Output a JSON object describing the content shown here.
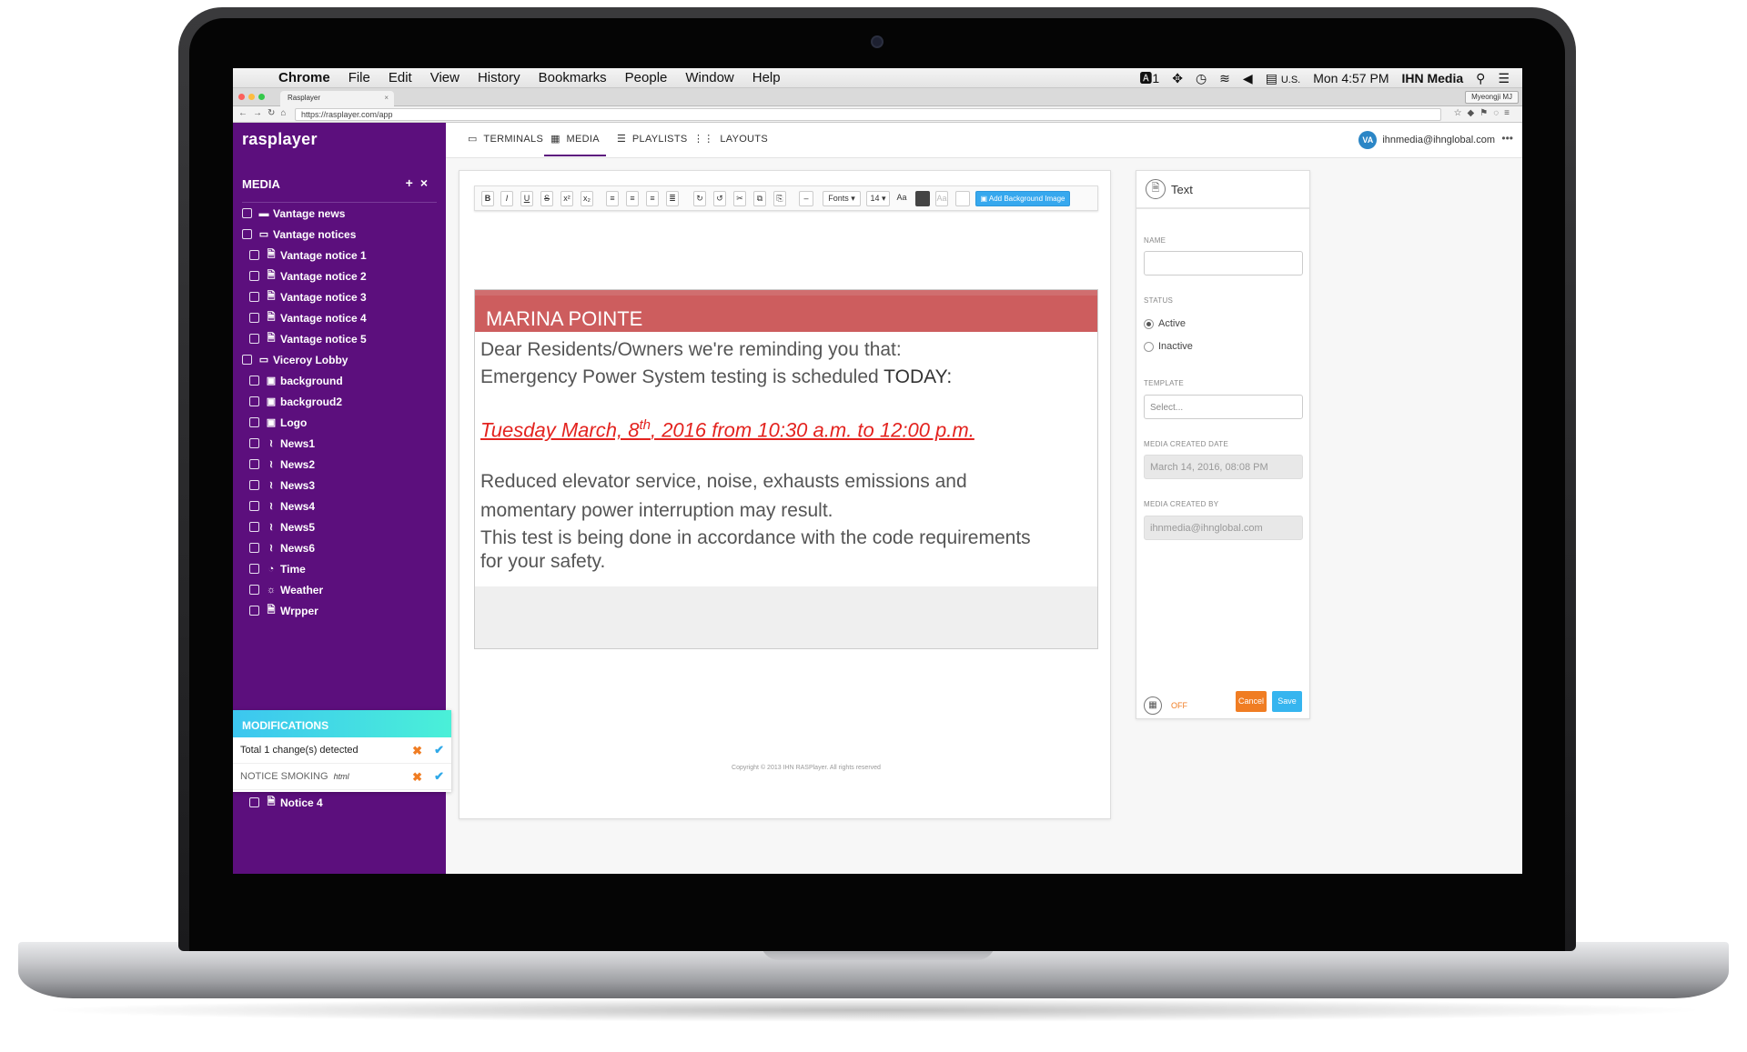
{
  "menubar": {
    "app": "Chrome",
    "items": [
      "File",
      "Edit",
      "View",
      "History",
      "Bookmarks",
      "People",
      "Window",
      "Help"
    ],
    "right": {
      "indicator": "1",
      "locale": "U.S.",
      "clock": "Mon 4:57 PM",
      "user": "IHN Media"
    }
  },
  "browser": {
    "tab_title": "Rasplayer",
    "tab_close": "×",
    "profile": "Myeongji MJ",
    "url": "https://rasplayer.com/app"
  },
  "sidebar": {
    "logo": "rasplayer",
    "media_title": "MEDIA",
    "items": [
      {
        "label": "Vantage news",
        "icon": "folder-icon",
        "indent": 0
      },
      {
        "label": "Vantage notices",
        "icon": "folder-open-icon",
        "indent": 0
      },
      {
        "label": "Vantage notice 1",
        "icon": "document-icon",
        "indent": 1
      },
      {
        "label": "Vantage notice 2",
        "icon": "document-icon",
        "indent": 1
      },
      {
        "label": "Vantage notice 3",
        "icon": "document-icon",
        "indent": 1
      },
      {
        "label": "Vantage notice 4",
        "icon": "document-icon",
        "indent": 1
      },
      {
        "label": "Vantage notice 5",
        "icon": "document-icon",
        "indent": 1
      },
      {
        "label": "Viceroy Lobby",
        "icon": "folder-open-icon",
        "indent": 0
      },
      {
        "label": "background",
        "icon": "image-icon",
        "indent": 1
      },
      {
        "label": "backgroud2",
        "icon": "image-icon",
        "indent": 1
      },
      {
        "label": "Logo",
        "icon": "image-icon",
        "indent": 1
      },
      {
        "label": "News1",
        "icon": "rss-icon",
        "indent": 1
      },
      {
        "label": "News2",
        "icon": "rss-icon",
        "indent": 1
      },
      {
        "label": "News3",
        "icon": "rss-icon",
        "indent": 1
      },
      {
        "label": "News4",
        "icon": "rss-icon",
        "indent": 1
      },
      {
        "label": "News5",
        "icon": "rss-icon",
        "indent": 1
      },
      {
        "label": "News6",
        "icon": "rss-icon",
        "indent": 1
      },
      {
        "label": "Time",
        "icon": "clock-icon",
        "indent": 1
      },
      {
        "label": "Weather",
        "icon": "sun-icon",
        "indent": 1
      },
      {
        "label": "Wrpper",
        "icon": "document-icon",
        "indent": 1
      }
    ],
    "modifications": {
      "title": "MODIFICATIONS",
      "total": "Total 1 change(s) detected",
      "change_name": "NOTICE SMOKING",
      "change_type": "html"
    },
    "trailing_item": "Notice 4"
  },
  "topnav": {
    "tabs": [
      "TERMINALS",
      "MEDIA",
      "PLAYLISTS",
      "LAYOUTS"
    ],
    "active": "MEDIA",
    "avatar": "VA",
    "email": "ihnmedia@ihnglobal.com"
  },
  "editor": {
    "toolbar": {
      "fonts": "Fonts ▾",
      "size": "14 ▾",
      "bg_button": "Add Background Image"
    },
    "banner": "MARINA POINTE",
    "line1": "Dear Residents/Owners we're reminding you that:",
    "line2": "Emergency Power System testing is scheduled",
    "line2_bold": "TODAY:",
    "date_pre": "Tuesday March, 8",
    "date_sup": "th",
    "date_post": ", 2016 from 10:30 a.m. to 12:00 p.m.",
    "line3": "Reduced elevator service, noise, exhausts emissions and",
    "line4": "momentary power interruption may result.",
    "line5": "This test is being done in accordance with the code requirements",
    "line6": "for your safety.",
    "copyright": "Copyright © 2013 IHN RASPlayer. All rights reserved"
  },
  "props": {
    "title": "Text",
    "name_label": "NAME",
    "status_label": "STATUS",
    "active": "Active",
    "inactive": "Inactive",
    "template_label": "TEMPLATE",
    "template_placeholder": "Select...",
    "created_date_label": "MEDIA CREATED DATE",
    "created_date": "March 14, 2016, 08:08 PM",
    "created_by_label": "MEDIA CREATED BY",
    "created_by": "ihnmedia@ihnglobal.com",
    "schedule": "OFF",
    "cancel": "Cancel",
    "save": "Save"
  },
  "colors": {
    "sidebar": "#5c0f7d",
    "banner": "#cd5d5e",
    "date": "#e3231f",
    "cancel": "#f07d23",
    "save": "#36b5ef"
  }
}
